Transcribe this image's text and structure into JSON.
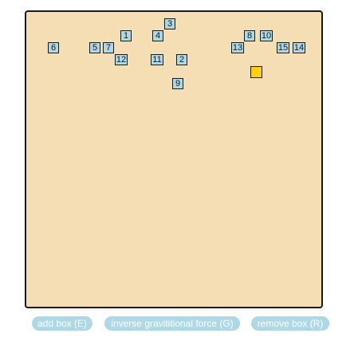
{
  "boxes": [
    {
      "label": "1"
    },
    {
      "label": "2"
    },
    {
      "label": "3"
    },
    {
      "label": "4"
    },
    {
      "label": "5"
    },
    {
      "label": "6"
    },
    {
      "label": "7"
    },
    {
      "label": "8"
    },
    {
      "label": "9"
    },
    {
      "label": "10"
    },
    {
      "label": "11"
    },
    {
      "label": "12"
    },
    {
      "label": "13"
    },
    {
      "label": "14"
    },
    {
      "label": "15"
    }
  ],
  "colors": {
    "background": "#f5deb3",
    "box_fill": "#add8e6",
    "player_fill": "#ffd200",
    "button_fill": "#add8e6",
    "button_text": "#ffffff"
  },
  "buttons": {
    "add_label": "add box (E)",
    "gravity_label": "inverse gravititional force (G)",
    "remove_label": "remove box (R)"
  }
}
